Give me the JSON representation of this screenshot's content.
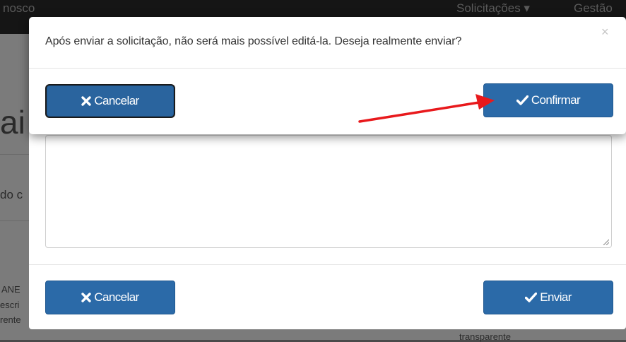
{
  "background": {
    "navbar": {
      "left_text": "nosco",
      "menu_requests": "Solicitações ▾",
      "menu_management": "Gestão"
    },
    "page": {
      "big_heading_fragment": "ai",
      "field_fragment": "do c",
      "bottom_left_lines": [
        "ANE",
        "escri",
        "rente"
      ],
      "bottom_right_text": "transparente"
    }
  },
  "lower_modal": {
    "cancel_label": "Cancelar",
    "submit_label": "Enviar"
  },
  "confirm_modal": {
    "message": "Após enviar a solicitação, não será mais possível editá-la. Deseja realmente enviar?",
    "close_symbol": "×",
    "cancel_label": "Cancelar",
    "confirm_label": "Confirmar"
  },
  "colors": {
    "button_primary": "#2b6aa8",
    "annotation_arrow": "#e8191c"
  }
}
